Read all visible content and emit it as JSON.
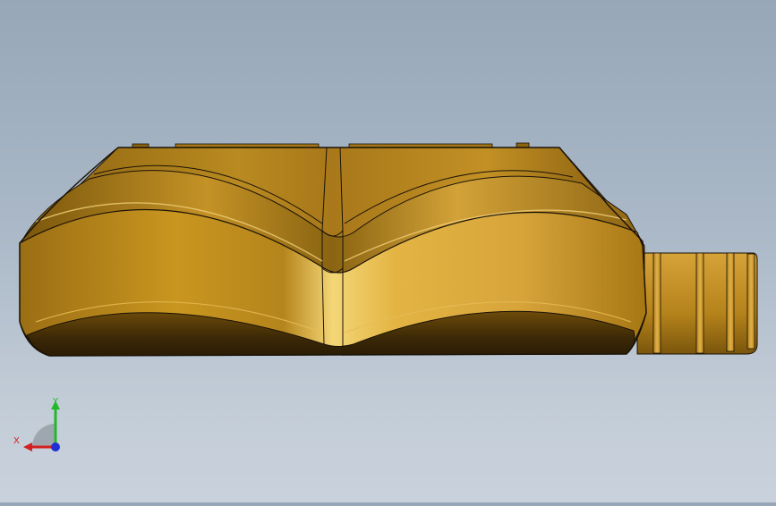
{
  "viewport": {
    "background_top": "#97a7b8",
    "background_bottom": "#c9d2dc"
  },
  "model": {
    "material_color": "#c8951f",
    "edge_color": "#1a1208",
    "highlight_color": "#f3d070",
    "shadow_color": "#5a3c08"
  },
  "triad": {
    "x_label": "X",
    "y_label": "Y",
    "x_color": "#d41f1f",
    "y_color": "#23b82a",
    "z_color": "#1f2fd4"
  }
}
